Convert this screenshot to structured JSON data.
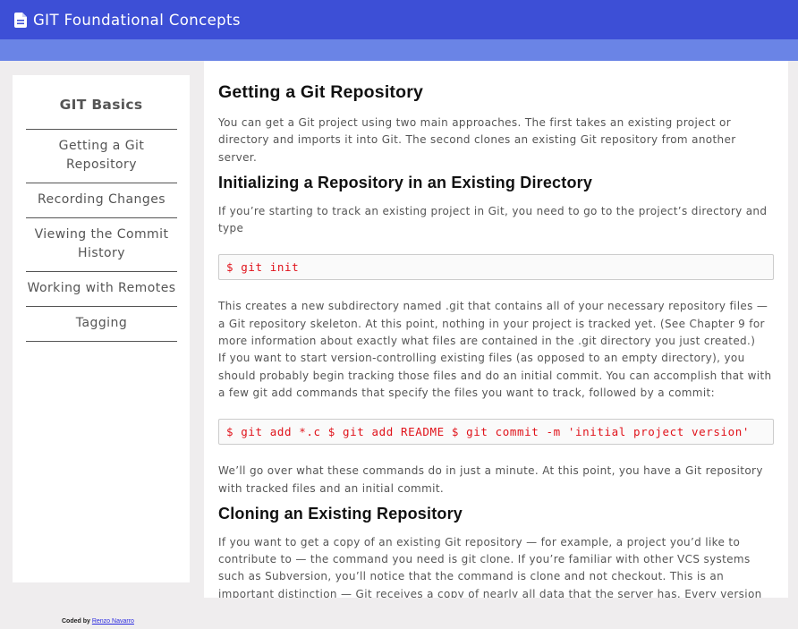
{
  "header": {
    "title": "GIT Foundational Concepts",
    "icon": "document-icon"
  },
  "sidebar": {
    "heading": "GIT Basics",
    "items": [
      {
        "label": "Getting a Git Repository"
      },
      {
        "label": "Recording Changes"
      },
      {
        "label": "Viewing the Commit History"
      },
      {
        "label": "Working with Remotes"
      },
      {
        "label": "Tagging"
      }
    ]
  },
  "main": {
    "title": "Getting a Git Repository",
    "intro": "You can get a Git project using two main approaches. The first takes an existing project or directory and imports it into Git. The second clones an existing Git repository from another server.",
    "section1": {
      "heading": "Initializing a Repository in an Existing Directory",
      "p1": "If you’re starting to track an existing project in Git, you need to go to the project’s directory and type",
      "code1": "$ git init",
      "p2": "This creates a new subdirectory named .git that contains all of your necessary repository files — a Git repository skeleton. At this point, nothing in your project is tracked yet. (See Chapter 9 for more information about exactly what files are contained in the .git directory you just created.)",
      "p3": "If you want to start version-controlling existing files (as opposed to an empty directory), you should probably begin tracking those files and do an initial commit. You can accomplish that with a few git add commands that specify the files you want to track, followed by a commit:",
      "code2": "$ git add *.c $ git add README $ git commit -m 'initial project version'",
      "p4": "We’ll go over what these commands do in just a minute. At this point, you have a Git repository with tracked files and an initial commit."
    },
    "section2": {
      "heading": "Cloning an Existing Repository",
      "p1": "If you want to get a copy of an existing Git repository — for example, a project you’d like to contribute to — the command you need is git clone. If you’re familiar with other VCS systems such as Subversion, you’ll notice that the command is clone and not checkout. This is an important distinction — Git receives a copy of nearly all data that the server has. Every version of every file for the history of the project is pulled down when you run git clone. In fact, if your server disk gets corrupted, you can use any of the"
    }
  },
  "footer": {
    "prefix": "Coded by",
    "author": "Renzo Navarro"
  },
  "colors": {
    "header_bg": "#3d4fd6",
    "subbar_bg": "#6a84e6",
    "code_text": "#e0121a",
    "page_bg": "#efedee"
  }
}
